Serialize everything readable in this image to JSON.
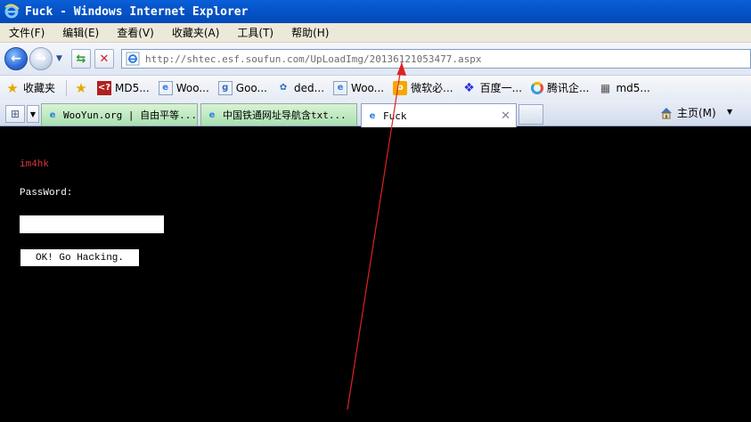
{
  "window": {
    "title": "Fuck - Windows Internet Explorer"
  },
  "menu": {
    "items": [
      "文件(F)",
      "编辑(E)",
      "查看(V)",
      "收藏夹(A)",
      "工具(T)",
      "帮助(H)"
    ]
  },
  "address": {
    "url": "http://shtec.esf.soufun.com/UpLoadImg/20136121053477.aspx"
  },
  "favorites": {
    "label": "收藏夹",
    "items": [
      {
        "label": "MD5...",
        "icon": "md5-site-icon"
      },
      {
        "label": "Woo...",
        "icon": "ie-page-icon"
      },
      {
        "label": "Goo...",
        "icon": "google-icon"
      },
      {
        "label": "ded...",
        "icon": "dede-icon"
      },
      {
        "label": "Woo...",
        "icon": "ie-page-icon"
      },
      {
        "label": "微软必...",
        "icon": "bing-icon"
      },
      {
        "label": "百度一...",
        "icon": "baidu-icon"
      },
      {
        "label": "腾讯企...",
        "icon": "tencent-icon"
      },
      {
        "label": "md5...",
        "icon": "grid-icon"
      }
    ]
  },
  "tabs": [
    {
      "label": "WooYun.org | 自由平等..."
    },
    {
      "label": "中国铁通网址导航含txt..."
    },
    {
      "label": "Fuck"
    }
  ],
  "toolbar": {
    "home_label": "主页(M)"
  },
  "page": {
    "brand": "im4hk",
    "password_label": "PassWord:",
    "password_value": "",
    "submit_label": "OK! Go Hacking."
  },
  "colors": {
    "titlebar": "#0654c8",
    "brand_text": "#e0393e",
    "page_bg": "#000000",
    "annotation_arrow": "#e02020"
  }
}
